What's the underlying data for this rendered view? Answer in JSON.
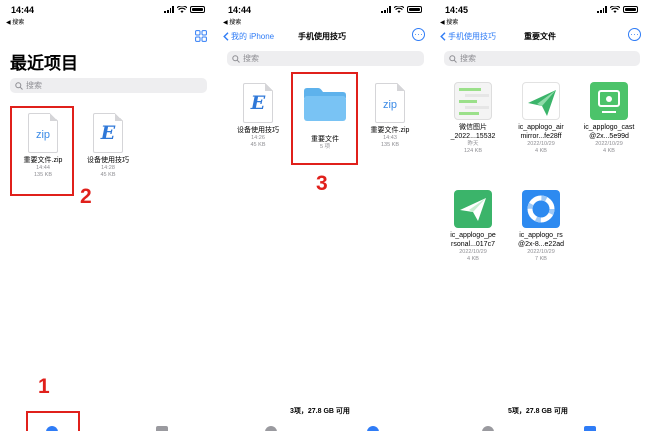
{
  "status_back_label": "◀ 搜索",
  "panel1": {
    "time": "14:44",
    "title": "最近项目",
    "search_placeholder": "搜索",
    "files": [
      {
        "name": "重要文件.zip",
        "time": "14:44",
        "size": "135 KB"
      },
      {
        "name": "设备使用技巧",
        "time": "14:28",
        "size": "45 KB"
      }
    ],
    "doc_icon_zip": "zip",
    "doc_icon_e": "E",
    "step1": "1",
    "step2": "2"
  },
  "panel2": {
    "time": "14:44",
    "back_label": "我的 iPhone",
    "title": "手机使用技巧",
    "search_placeholder": "搜索",
    "files": [
      {
        "name": "设备使用技巧",
        "time": "14:26",
        "size": "45 KB"
      },
      {
        "name": "重要文件",
        "time": "5 项",
        "size": ""
      },
      {
        "name": "重要文件.zip",
        "time": "14:43",
        "size": "135 KB"
      }
    ],
    "step3": "3",
    "footer": "3项，27.8 GB 可用"
  },
  "panel3": {
    "time": "14:45",
    "back_label": "手机使用技巧",
    "title": "重要文件",
    "search_placeholder": "搜索",
    "files": [
      {
        "name1": "微信图片",
        "name2": "_2022...15532",
        "time": "昨天",
        "size": "124 KB"
      },
      {
        "name1": "ic_applogo_air",
        "name2": "mirror...fe28ff",
        "time": "2022/10/29",
        "size": "4 KB"
      },
      {
        "name1": "ic_applogo_cast",
        "name2": "@2x...5e99d",
        "time": "2022/10/29",
        "size": "4 KB"
      },
      {
        "name1": "ic_applogo_pe",
        "name2": "rsonal...017c7",
        "time": "2022/10/29",
        "size": "4 KB"
      },
      {
        "name1": "ic_applogo_rs",
        "name2": "@2x-8...e22ad",
        "time": "2022/10/29",
        "size": "7 KB"
      }
    ],
    "footer": "5项，27.8 GB 可用"
  },
  "colors": {
    "accent": "#2f7cf6",
    "highlight": "#e0201b",
    "folder": "#79c3f4",
    "green": "#4cc36a"
  }
}
